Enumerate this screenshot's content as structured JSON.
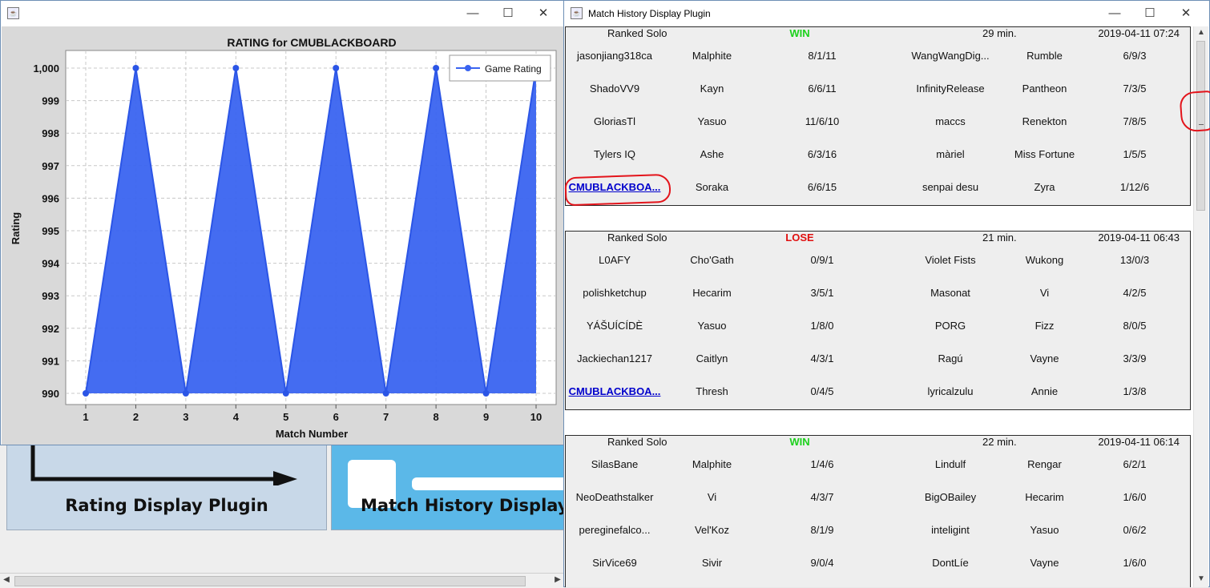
{
  "background": {
    "tiles": [
      {
        "label": "Rating Display Plugin"
      },
      {
        "label": "Match History Display"
      }
    ]
  },
  "chart_window": {
    "title": "",
    "icon": "java-cup-icon",
    "controls": [
      "minimize",
      "maximize",
      "close"
    ]
  },
  "chart_data": {
    "type": "area",
    "title": "RATING for CMUBLACKBOARD",
    "xlabel": "Match Number",
    "ylabel": "Rating",
    "x": [
      1,
      2,
      3,
      4,
      5,
      6,
      7,
      8,
      9,
      10
    ],
    "series": [
      {
        "name": "Game Rating",
        "values": [
          990,
          1000,
          990,
          1000,
          990,
          1000,
          990,
          1000,
          990,
          1000
        ],
        "color": "#3a64f0"
      }
    ],
    "ylim": [
      990,
      1000
    ],
    "yticks": [
      "990",
      "991",
      "992",
      "993",
      "994",
      "995",
      "996",
      "997",
      "998",
      "999",
      "1,000"
    ],
    "xticks": [
      "1",
      "2",
      "3",
      "4",
      "5",
      "6",
      "7",
      "8",
      "9",
      "10"
    ],
    "grid": true,
    "legend": "top-right"
  },
  "history_window": {
    "title": "Match History Display Plugin",
    "icon": "java-cup-icon",
    "matches": [
      {
        "queue": "Ranked Solo",
        "result": "WIN",
        "result_color": "#1cd11c",
        "duration": "29 min.",
        "date": "2019-04-11 07:24",
        "rows": [
          [
            "jasonjiang318ca",
            "Malphite",
            "8/1/11",
            "WangWangDig...",
            "Rumble",
            "6/9/3"
          ],
          [
            "ShadoVV9",
            "Kayn",
            "6/6/11",
            "InfinityRelease",
            "Pantheon",
            "7/3/5"
          ],
          [
            "GloriasTl",
            "Yasuo",
            "11/6/10",
            "maccs",
            "Renekton",
            "7/8/5"
          ],
          [
            "Tylers IQ",
            "Ashe",
            "6/3/16",
            "màriel",
            "Miss Fortune",
            "1/5/5"
          ],
          [
            "CMUBLACKBOA...",
            "Soraka",
            "6/6/15",
            "senpai desu",
            "Zyra",
            "1/12/6"
          ]
        ]
      },
      {
        "queue": "Ranked Solo",
        "result": "LOSE",
        "result_color": "#e01010",
        "duration": "21 min.",
        "date": "2019-04-11 06:43",
        "rows": [
          [
            "L0AFY",
            "Cho'Gath",
            "0/9/1",
            "Violet Fists",
            "Wukong",
            "13/0/3"
          ],
          [
            "polishketchup",
            "Hecarim",
            "3/5/1",
            "Masonat",
            "Vi",
            "4/2/5"
          ],
          [
            "YÁŠUÍCÍDÈ",
            "Yasuo",
            "1/8/0",
            "PORG",
            "Fizz",
            "8/0/5"
          ],
          [
            "Jackiechan1217",
            "Caitlyn",
            "4/3/1",
            "Ragú",
            "Vayne",
            "3/3/9"
          ],
          [
            "CMUBLACKBOA...",
            "Thresh",
            "0/4/5",
            "lyricalzulu",
            "Annie",
            "1/3/8"
          ]
        ]
      },
      {
        "queue": "Ranked Solo",
        "result": "WIN",
        "result_color": "#1cd11c",
        "duration": "22 min.",
        "date": "2019-04-11 06:14",
        "rows": [
          [
            "SilasBane",
            "Malphite",
            "1/4/6",
            "Lindulf",
            "Rengar",
            "6/2/1"
          ],
          [
            "NeoDeathstalker",
            "Vi",
            "4/3/7",
            "BigOBailey",
            "Hecarim",
            "1/6/0"
          ],
          [
            "pereginefalco...",
            "Vel'Koz",
            "8/1/9",
            "inteligint",
            "Yasuo",
            "0/6/2"
          ],
          [
            "SirVice69",
            "Sivir",
            "9/0/4",
            "DontLíe",
            "Vayne",
            "1/6/0"
          ]
        ]
      }
    ]
  }
}
